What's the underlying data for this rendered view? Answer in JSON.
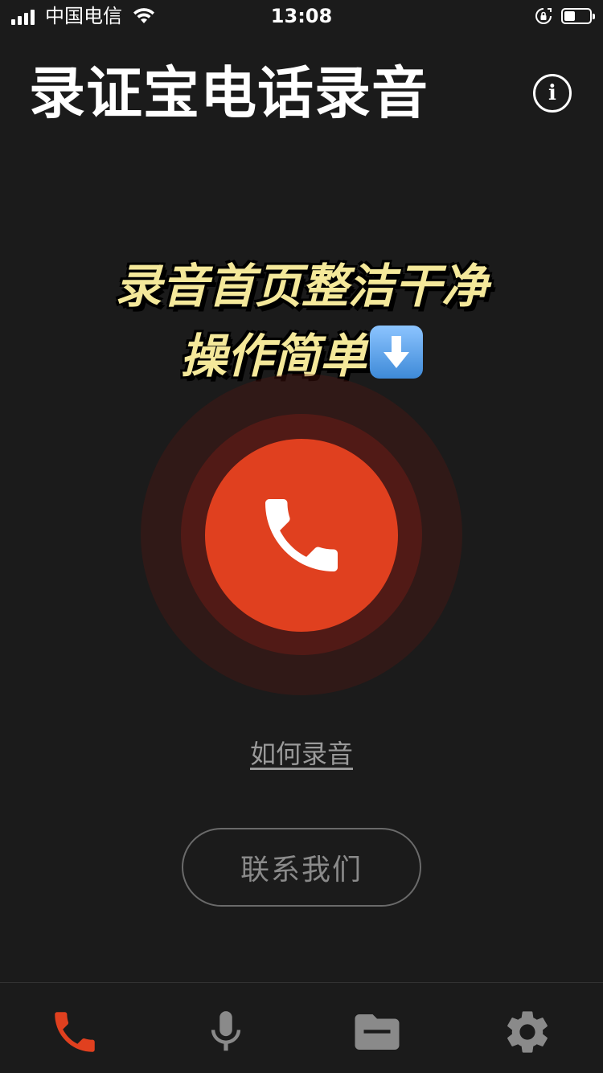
{
  "status_bar": {
    "carrier": "中国电信",
    "time": "13:08"
  },
  "header": {
    "title": "录证宝电话录音",
    "info_icon": "info-icon",
    "info_glyph": "i"
  },
  "overlay": {
    "line1": "录音首页整洁干净",
    "line2": "操作简单"
  },
  "main": {
    "call_icon": "phone-icon",
    "how_to_record": "如何录音",
    "contact_us": "联系我们"
  },
  "tabbar": {
    "tabs": [
      {
        "icon": "phone-icon",
        "active": true
      },
      {
        "icon": "microphone-icon",
        "active": false
      },
      {
        "icon": "folder-icon",
        "active": false
      },
      {
        "icon": "gear-icon",
        "active": false
      }
    ]
  },
  "colors": {
    "background": "#1b1b1b",
    "accent": "#e0401f",
    "inactive": "#8a8a8a",
    "caption": "#f4e89a"
  }
}
